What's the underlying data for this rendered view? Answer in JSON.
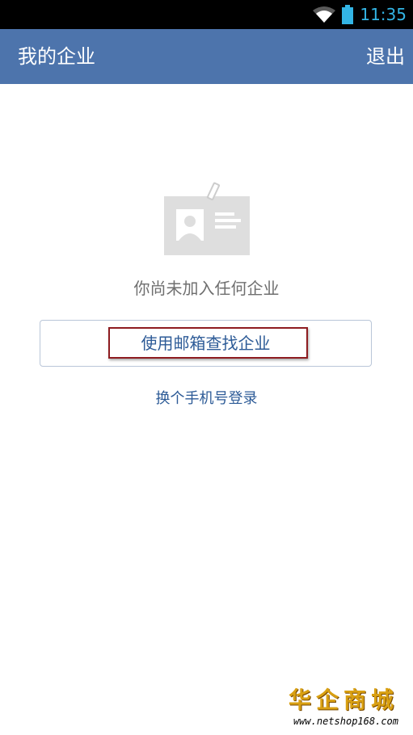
{
  "status_bar": {
    "time": "11:35",
    "icons": [
      "wifi-icon",
      "battery-icon"
    ],
    "accent_color": "#33b5e5"
  },
  "app_bar": {
    "title": "我的企业",
    "logout_label": "退出",
    "background_color": "#4d74ac"
  },
  "main": {
    "illustration_icon": "id-card-icon",
    "empty_message": "你尚未加入任何企业",
    "email_find_label": "使用邮箱查找企业",
    "switch_phone_label": "换个手机号登录",
    "link_color": "#2d5b97",
    "highlight_color": "#8e1c20"
  },
  "watermark": {
    "title": "华企商城",
    "url": "www.netshop168.com"
  }
}
